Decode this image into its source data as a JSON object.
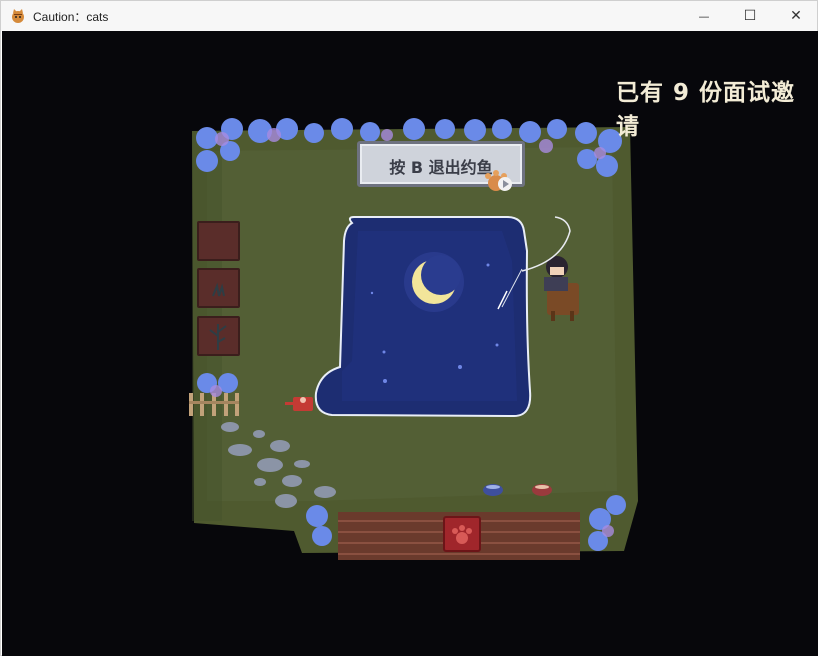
{
  "window": {
    "title": "Caution：cats",
    "minimize_icon": "minimize-icon",
    "maximize_icon": "maximize-icon",
    "close_icon": "close-icon",
    "minimize_glyph": "—",
    "maximize_glyph": "☐",
    "close_glyph": "✕"
  },
  "hud": {
    "invitations_text": "已有 9 份面试邀请"
  },
  "sign": {
    "text": "按 B 退出约鱼"
  },
  "colors": {
    "background": "#07070b",
    "grass": "#4f5a2f",
    "pond": "#1d2d72",
    "flowers": "#6a8ae8",
    "sign": "#cfd3db",
    "hud_text": "#f3ecd6"
  },
  "icons": [
    "cat-app-icon",
    "moon-icon",
    "paw-icon",
    "fishing-rod-icon",
    "watering-can-icon",
    "bowl-icon",
    "sprout-icon"
  ]
}
